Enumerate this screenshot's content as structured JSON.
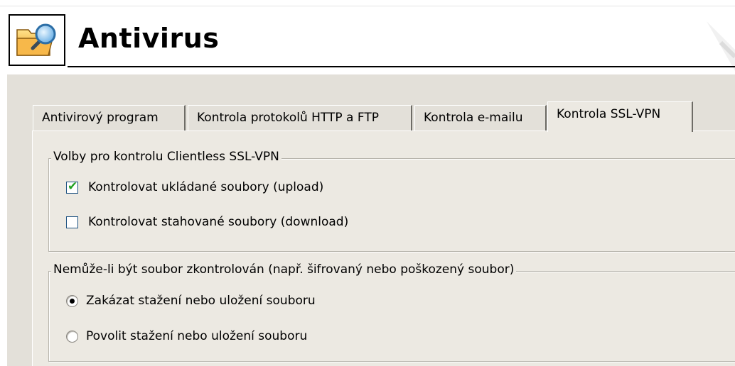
{
  "header": {
    "title": "Antivirus"
  },
  "tabs": [
    {
      "label": "Antivirový program",
      "active": false
    },
    {
      "label": "Kontrola protokolů HTTP a FTP",
      "active": false
    },
    {
      "label": "Kontrola e-mailu",
      "active": false
    },
    {
      "label": "Kontrola SSL-VPN",
      "active": true
    }
  ],
  "ssl_vpn_group": {
    "label": "Volby pro kontrolu Clientless SSL-VPN",
    "options": [
      {
        "label": "Kontrolovat ukládané soubory (upload)",
        "checked": true
      },
      {
        "label": "Kontrolovat stahované soubory (download)",
        "checked": false
      }
    ]
  },
  "unchecked_file_group": {
    "label": "Nemůže-li být soubor zkontrolován (např. šifrovaný nebo poškozený soubor)",
    "options": [
      {
        "label": "Zakázat stažení nebo uložení souboru",
        "selected": true
      },
      {
        "label": "Povolit stažení nebo uložení souboru",
        "selected": false
      }
    ]
  },
  "colors": {
    "panel_bg": "#e3e0d9",
    "tab_content_bg": "#ece9e2",
    "check_mark": "#21a121"
  },
  "icons": {
    "app_icon": "folder-magnifier-icon"
  }
}
